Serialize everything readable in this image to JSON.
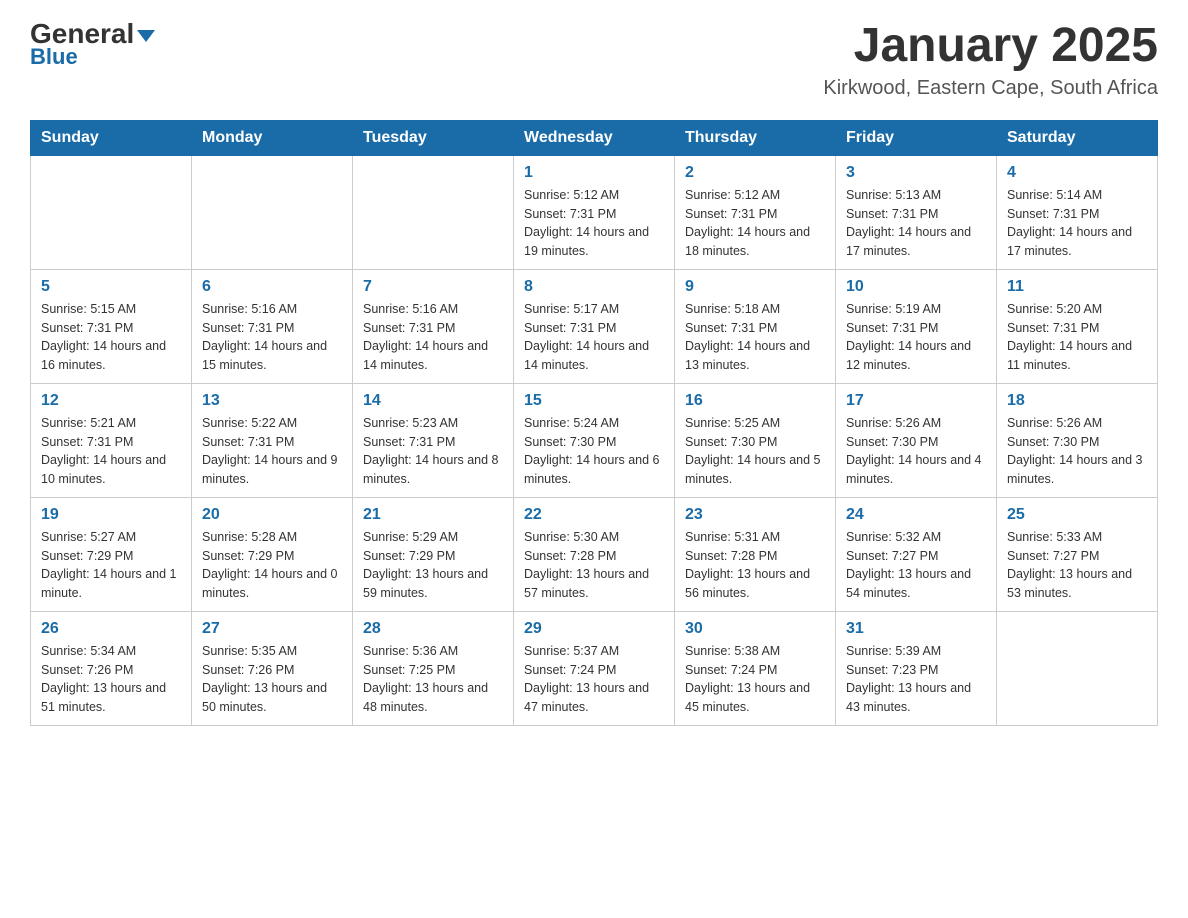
{
  "logo": {
    "general": "General",
    "blue": "Blue"
  },
  "title": "January 2025",
  "location": "Kirkwood, Eastern Cape, South Africa",
  "days_of_week": [
    "Sunday",
    "Monday",
    "Tuesday",
    "Wednesday",
    "Thursday",
    "Friday",
    "Saturday"
  ],
  "weeks": [
    [
      {
        "day": "",
        "info": ""
      },
      {
        "day": "",
        "info": ""
      },
      {
        "day": "",
        "info": ""
      },
      {
        "day": "1",
        "info": "Sunrise: 5:12 AM\nSunset: 7:31 PM\nDaylight: 14 hours\nand 19 minutes."
      },
      {
        "day": "2",
        "info": "Sunrise: 5:12 AM\nSunset: 7:31 PM\nDaylight: 14 hours\nand 18 minutes."
      },
      {
        "day": "3",
        "info": "Sunrise: 5:13 AM\nSunset: 7:31 PM\nDaylight: 14 hours\nand 17 minutes."
      },
      {
        "day": "4",
        "info": "Sunrise: 5:14 AM\nSunset: 7:31 PM\nDaylight: 14 hours\nand 17 minutes."
      }
    ],
    [
      {
        "day": "5",
        "info": "Sunrise: 5:15 AM\nSunset: 7:31 PM\nDaylight: 14 hours\nand 16 minutes."
      },
      {
        "day": "6",
        "info": "Sunrise: 5:16 AM\nSunset: 7:31 PM\nDaylight: 14 hours\nand 15 minutes."
      },
      {
        "day": "7",
        "info": "Sunrise: 5:16 AM\nSunset: 7:31 PM\nDaylight: 14 hours\nand 14 minutes."
      },
      {
        "day": "8",
        "info": "Sunrise: 5:17 AM\nSunset: 7:31 PM\nDaylight: 14 hours\nand 14 minutes."
      },
      {
        "day": "9",
        "info": "Sunrise: 5:18 AM\nSunset: 7:31 PM\nDaylight: 14 hours\nand 13 minutes."
      },
      {
        "day": "10",
        "info": "Sunrise: 5:19 AM\nSunset: 7:31 PM\nDaylight: 14 hours\nand 12 minutes."
      },
      {
        "day": "11",
        "info": "Sunrise: 5:20 AM\nSunset: 7:31 PM\nDaylight: 14 hours\nand 11 minutes."
      }
    ],
    [
      {
        "day": "12",
        "info": "Sunrise: 5:21 AM\nSunset: 7:31 PM\nDaylight: 14 hours\nand 10 minutes."
      },
      {
        "day": "13",
        "info": "Sunrise: 5:22 AM\nSunset: 7:31 PM\nDaylight: 14 hours\nand 9 minutes."
      },
      {
        "day": "14",
        "info": "Sunrise: 5:23 AM\nSunset: 7:31 PM\nDaylight: 14 hours\nand 8 minutes."
      },
      {
        "day": "15",
        "info": "Sunrise: 5:24 AM\nSunset: 7:30 PM\nDaylight: 14 hours\nand 6 minutes."
      },
      {
        "day": "16",
        "info": "Sunrise: 5:25 AM\nSunset: 7:30 PM\nDaylight: 14 hours\nand 5 minutes."
      },
      {
        "day": "17",
        "info": "Sunrise: 5:26 AM\nSunset: 7:30 PM\nDaylight: 14 hours\nand 4 minutes."
      },
      {
        "day": "18",
        "info": "Sunrise: 5:26 AM\nSunset: 7:30 PM\nDaylight: 14 hours\nand 3 minutes."
      }
    ],
    [
      {
        "day": "19",
        "info": "Sunrise: 5:27 AM\nSunset: 7:29 PM\nDaylight: 14 hours\nand 1 minute."
      },
      {
        "day": "20",
        "info": "Sunrise: 5:28 AM\nSunset: 7:29 PM\nDaylight: 14 hours\nand 0 minutes."
      },
      {
        "day": "21",
        "info": "Sunrise: 5:29 AM\nSunset: 7:29 PM\nDaylight: 13 hours\nand 59 minutes."
      },
      {
        "day": "22",
        "info": "Sunrise: 5:30 AM\nSunset: 7:28 PM\nDaylight: 13 hours\nand 57 minutes."
      },
      {
        "day": "23",
        "info": "Sunrise: 5:31 AM\nSunset: 7:28 PM\nDaylight: 13 hours\nand 56 minutes."
      },
      {
        "day": "24",
        "info": "Sunrise: 5:32 AM\nSunset: 7:27 PM\nDaylight: 13 hours\nand 54 minutes."
      },
      {
        "day": "25",
        "info": "Sunrise: 5:33 AM\nSunset: 7:27 PM\nDaylight: 13 hours\nand 53 minutes."
      }
    ],
    [
      {
        "day": "26",
        "info": "Sunrise: 5:34 AM\nSunset: 7:26 PM\nDaylight: 13 hours\nand 51 minutes."
      },
      {
        "day": "27",
        "info": "Sunrise: 5:35 AM\nSunset: 7:26 PM\nDaylight: 13 hours\nand 50 minutes."
      },
      {
        "day": "28",
        "info": "Sunrise: 5:36 AM\nSunset: 7:25 PM\nDaylight: 13 hours\nand 48 minutes."
      },
      {
        "day": "29",
        "info": "Sunrise: 5:37 AM\nSunset: 7:24 PM\nDaylight: 13 hours\nand 47 minutes."
      },
      {
        "day": "30",
        "info": "Sunrise: 5:38 AM\nSunset: 7:24 PM\nDaylight: 13 hours\nand 45 minutes."
      },
      {
        "day": "31",
        "info": "Sunrise: 5:39 AM\nSunset: 7:23 PM\nDaylight: 13 hours\nand 43 minutes."
      },
      {
        "day": "",
        "info": ""
      }
    ]
  ]
}
